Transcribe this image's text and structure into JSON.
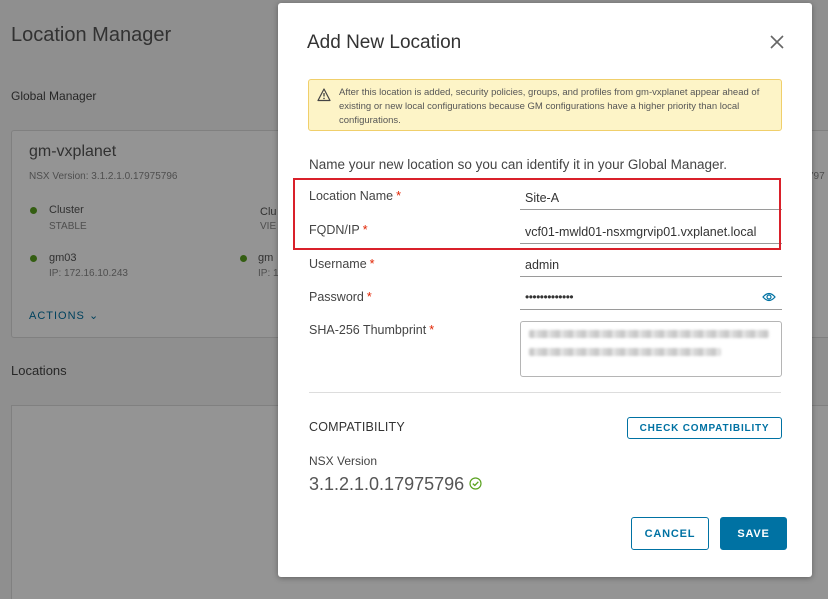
{
  "background": {
    "page_title": "Location Manager",
    "global_manager_label": "Global Manager",
    "node_name": "gm-vxplanet",
    "node_version": "NSX Version: 3.1.2.1.0.17975796",
    "right_version_fragment": "797",
    "cluster_label": "Cluster",
    "cluster_status": "STABLE",
    "cluster2_label": "Clu",
    "cluster2_status": "VIE",
    "node1_name": "gm03",
    "node1_ip": "IP: 172.16.10.243",
    "node2_name": "gm",
    "node2_ip": "IP: 1",
    "actions_label": "ACTIONS ⌄",
    "locations_label": "Locations"
  },
  "modal": {
    "title": "Add New Location",
    "alert_text": "After this location is added, security policies, groups, and profiles from gm-vxplanet appear ahead of existing or new local configurations because GM configurations have a higher priority than local configurations.",
    "intro": "Name your new location so you can identify it in your Global Manager.",
    "required_mark": "*",
    "fields": {
      "location_name": {
        "label": "Location Name",
        "value": "Site-A"
      },
      "fqdn": {
        "label": "FQDN/IP",
        "value": "vcf01-mwld01-nsxmgrvip01.vxplanet.local"
      },
      "username": {
        "label": "Username",
        "value": "admin"
      },
      "password": {
        "label": "Password",
        "value": "•••••••••••••"
      },
      "thumbprint": {
        "label": "SHA-256 Thumbprint"
      }
    },
    "compatibility": {
      "title": "COMPATIBILITY",
      "check_button": "CHECK COMPATIBILITY",
      "nsx_label": "NSX Version",
      "nsx_value": "3.1.2.1.0.17975796"
    },
    "buttons": {
      "cancel": "CANCEL",
      "save": "SAVE"
    }
  },
  "colors": {
    "accent": "#0072a3",
    "required": "#e12200",
    "highlight": "#d9202a",
    "success": "#5aa220",
    "alert_bg": "#fdf4c7"
  }
}
